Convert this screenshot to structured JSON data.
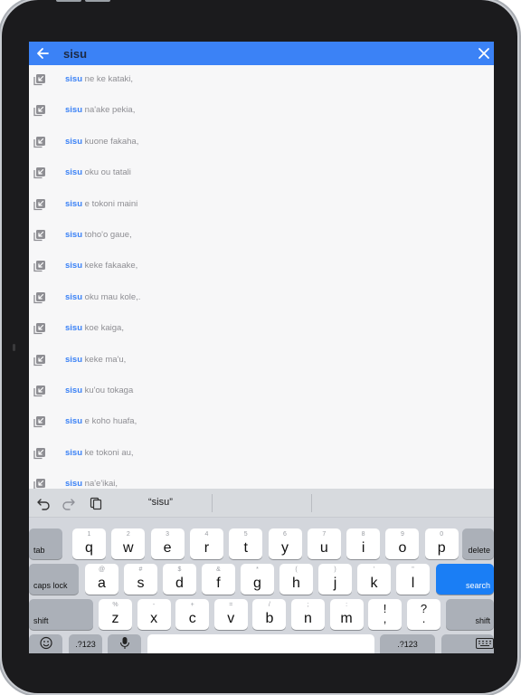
{
  "search": {
    "query": "sisu"
  },
  "suggestions": [
    {
      "prefix": "sisu",
      "rest": " ne ke kataki,"
    },
    {
      "prefix": "sisu",
      "rest": " na'ake pekia,"
    },
    {
      "prefix": "sisu",
      "rest": " kuone fakaha,"
    },
    {
      "prefix": "sisu",
      "rest": " oku ou tatali"
    },
    {
      "prefix": "sisu",
      "rest": " e tokoni maini"
    },
    {
      "prefix": "sisu",
      "rest": " toho'o gaue,"
    },
    {
      "prefix": "sisu",
      "rest": " keke fakaake,"
    },
    {
      "prefix": "sisu",
      "rest": " oku mau kole,."
    },
    {
      "prefix": "sisu",
      "rest": " koe kaiga,"
    },
    {
      "prefix": "sisu",
      "rest": " keke ma'u,"
    },
    {
      "prefix": "sisu",
      "rest": " ku'ou tokaga"
    },
    {
      "prefix": "sisu",
      "rest": " e koho huafa,"
    },
    {
      "prefix": "sisu",
      "rest": " ke tokoni au,"
    },
    {
      "prefix": "sisu",
      "rest": " na'e'ikai,"
    }
  ],
  "keyboard": {
    "prediction": "“sisu”",
    "row1": [
      {
        "main": "q",
        "alt": "1"
      },
      {
        "main": "w",
        "alt": "2"
      },
      {
        "main": "e",
        "alt": "3"
      },
      {
        "main": "r",
        "alt": "4"
      },
      {
        "main": "t",
        "alt": "5"
      },
      {
        "main": "y",
        "alt": "6"
      },
      {
        "main": "u",
        "alt": "7"
      },
      {
        "main": "i",
        "alt": "8"
      },
      {
        "main": "o",
        "alt": "9"
      },
      {
        "main": "p",
        "alt": "0"
      }
    ],
    "row2": [
      {
        "main": "a",
        "alt": "@"
      },
      {
        "main": "s",
        "alt": "#"
      },
      {
        "main": "d",
        "alt": "$"
      },
      {
        "main": "f",
        "alt": "&"
      },
      {
        "main": "g",
        "alt": "*"
      },
      {
        "main": "h",
        "alt": "("
      },
      {
        "main": "j",
        "alt": ")"
      },
      {
        "main": "k",
        "alt": "'"
      },
      {
        "main": "l",
        "alt": "\""
      }
    ],
    "row3": [
      {
        "main": "z",
        "alt": "%"
      },
      {
        "main": "x",
        "alt": "-"
      },
      {
        "main": "c",
        "alt": "+"
      },
      {
        "main": "v",
        "alt": "="
      },
      {
        "main": "b",
        "alt": "/"
      },
      {
        "main": "n",
        "alt": ";"
      },
      {
        "main": "m",
        "alt": ":"
      }
    ],
    "punct1": {
      "top": "!",
      "bottom": ","
    },
    "punct2": {
      "top": "?",
      "bottom": "."
    },
    "tab_label": "tab",
    "delete_label": "delete",
    "caps_label": "caps lock",
    "search_label": "search",
    "shift_label": "shift",
    "numbers_label": ".?123"
  },
  "colors": {
    "accent": "#3b82f6",
    "search_key": "#1a7ef5",
    "keyboard_bg": "#d3d6dc"
  }
}
